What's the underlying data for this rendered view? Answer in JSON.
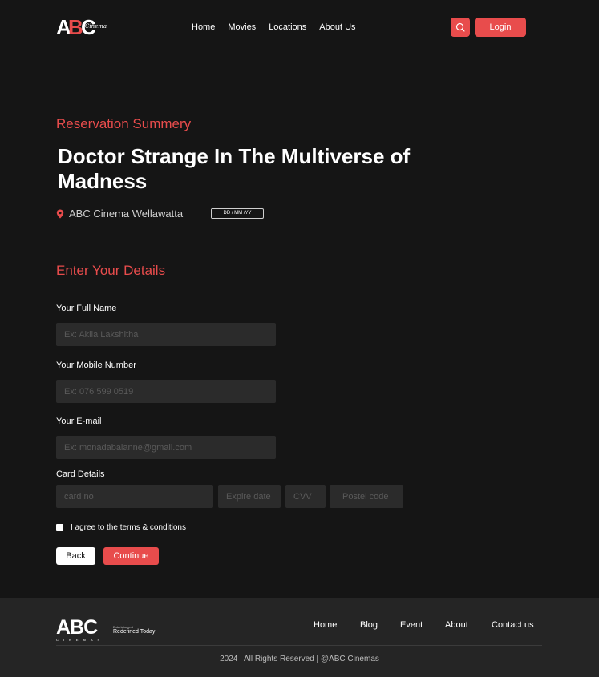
{
  "header": {
    "logo": {
      "letters": [
        "A",
        "B",
        "C"
      ],
      "script_text": "Cinema"
    },
    "nav": [
      "Home",
      "Movies",
      "Locations",
      "About Us"
    ],
    "search_icon": "search-icon",
    "login_label": "Login"
  },
  "summary": {
    "heading": "Reservation Summery",
    "movie_title": "Doctor Strange In The Multiverse of Madness",
    "location_icon": "map-pin-icon",
    "cinema": "ABC Cinema Wellawatta",
    "date_placeholder": "DD / MM /YY"
  },
  "form": {
    "heading": "Enter Your Details",
    "full_name": {
      "label": "Your Full Name",
      "placeholder": "Ex: Akila Lakshitha",
      "value": ""
    },
    "mobile": {
      "label": "Your Mobile Number",
      "placeholder": "Ex: 076 599 0519",
      "value": ""
    },
    "email": {
      "label": "Your E-mail",
      "placeholder": "Ex: monadabalanne@gmail.com",
      "value": ""
    },
    "card": {
      "label": "Card Details",
      "card_no_placeholder": "card no",
      "expire_placeholder": "Expire date",
      "cvv_placeholder": "CVV",
      "postal_placeholder": "Postel code"
    },
    "terms_label": "I agree to the terms & conditions",
    "terms_checked": false,
    "back_label": "Back",
    "continue_label": "Continue"
  },
  "footer": {
    "logo_text": "ABC",
    "logo_sub": "CINEMAS",
    "tag_small": "Entertainment",
    "tagline": "Redefined Today",
    "nav": [
      "Home",
      "Blog",
      "Event",
      "About",
      "Contact us"
    ],
    "copyright": "2024 | All Rights Reserved | @ABC Cinemas"
  },
  "colors": {
    "background": "#151515",
    "accent": "#e84c4c",
    "field": "#2b2b2b",
    "footer": "#252525"
  }
}
